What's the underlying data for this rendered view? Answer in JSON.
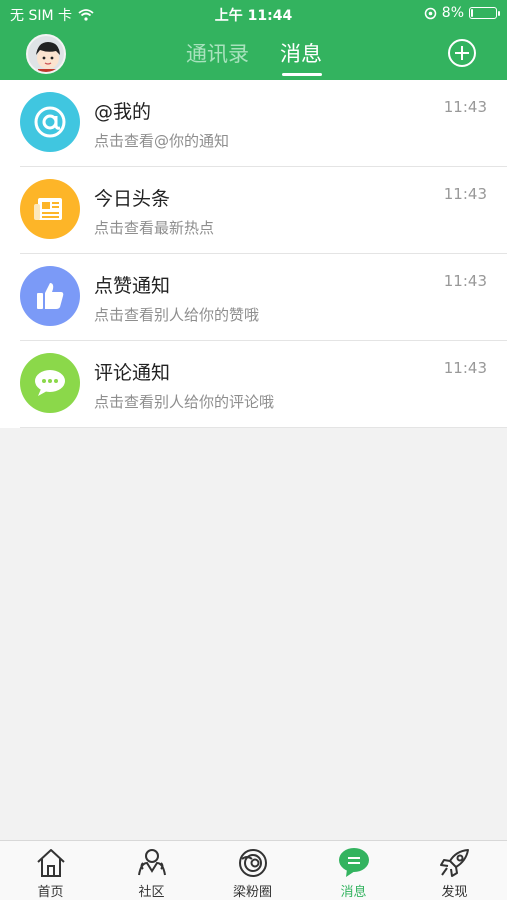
{
  "status_bar": {
    "carrier": "无 SIM 卡",
    "time": "上午 11:44",
    "battery": "8%",
    "battery_level": 0.08
  },
  "header": {
    "tabs": [
      "通讯录",
      "消息"
    ],
    "active_tab": "消息"
  },
  "messages": [
    {
      "title": "@我的",
      "subtitle": "点击查看@你的通知",
      "time": "11:43",
      "icon": "at-icon",
      "color": "#40c6e0"
    },
    {
      "title": "今日头条",
      "subtitle": "点击查看最新热点",
      "time": "11:43",
      "icon": "newspaper-icon",
      "color": "#fdb528"
    },
    {
      "title": "点赞通知",
      "subtitle": "点击查看别人给你的赞哦",
      "time": "11:43",
      "icon": "thumbs-up-icon",
      "color": "#7b9af7"
    },
    {
      "title": "评论通知",
      "subtitle": "点击查看别人给你的评论哦",
      "time": "11:43",
      "icon": "comment-icon",
      "color": "#8bd84a"
    }
  ],
  "tabbar": {
    "items": [
      {
        "label": "首页",
        "icon": "home-icon"
      },
      {
        "label": "社区",
        "icon": "community-icon"
      },
      {
        "label": "梁粉圈",
        "icon": "circle-icon"
      },
      {
        "label": "消息",
        "icon": "message-icon"
      },
      {
        "label": "发现",
        "icon": "rocket-icon"
      }
    ],
    "active": "消息"
  },
  "colors": {
    "primary": "#33b35f",
    "background": "#f2f2f2"
  }
}
